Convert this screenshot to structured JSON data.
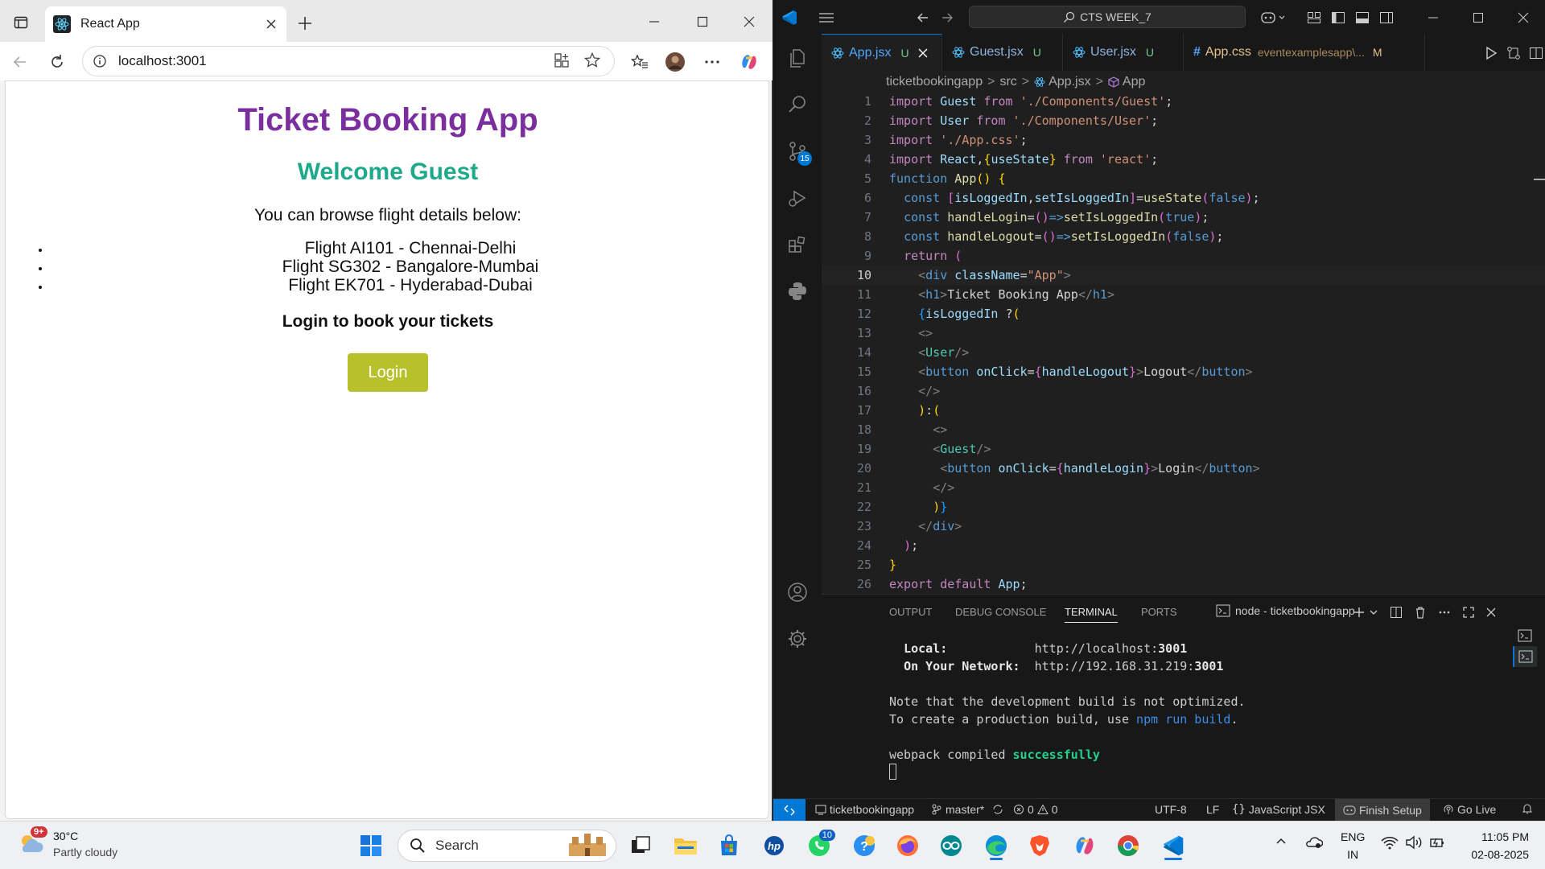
{
  "browser": {
    "tab_title": "React App",
    "url": "localhost:3001"
  },
  "app": {
    "heading": "Ticket Booking App",
    "welcome": "Welcome Guest",
    "intro": "You can browse flight details below:",
    "flights": [
      "Flight AI101 - Chennai-Delhi",
      "Flight SG302 - Bangalore-Mumbai",
      "Flight EK701 - Hyderabad-Dubai"
    ],
    "login_prompt": "Login to book your tickets",
    "login_button": "Login"
  },
  "vscode": {
    "command_center": "CTS WEEK_7",
    "source_control_badge": "15",
    "tabs": [
      {
        "name": "App.jsx",
        "status": "U"
      },
      {
        "name": "Guest.jsx",
        "status": "U"
      },
      {
        "name": "User.jsx",
        "status": "U"
      },
      {
        "name": "App.css",
        "detail": "eventexamplesapp\\...",
        "status": "M"
      }
    ],
    "breadcrumb": [
      "ticketbookingapp",
      "src",
      "App.jsx",
      "App"
    ],
    "line_numbers": [
      "1",
      "2",
      "3",
      "4",
      "5",
      "6",
      "7",
      "8",
      "9",
      "10",
      "11",
      "12",
      "13",
      "14",
      "15",
      "16",
      "17",
      "18",
      "19",
      "20",
      "21",
      "22",
      "23",
      "24",
      "25",
      "26"
    ],
    "panel_tabs": [
      "OUTPUT",
      "DEBUG CONSOLE",
      "TERMINAL",
      "PORTS"
    ],
    "terminal_name": "node - ticketbookingapp",
    "terminal": {
      "local_label": "Local:",
      "local_url": "http://localhost:",
      "local_port": "3001",
      "network_label": "On Your Network:",
      "network_url": "http://192.168.31.219:",
      "network_port": "3001",
      "note1": "Note that the development build is not optimized.",
      "note2_pre": "To create a production build, use ",
      "note2_cmd": "npm run build",
      "note2_post": ".",
      "compiled_pre": "webpack compiled ",
      "compiled_status": "successfully"
    },
    "status": {
      "folder": "ticketbookingapp",
      "branch": "master*",
      "errors": "0",
      "warnings": "0",
      "encoding": "UTF-8",
      "eol": "LF",
      "language": "JavaScript JSX",
      "finish_setup": "Finish Setup",
      "go_live": "Go Live"
    }
  },
  "taskbar": {
    "weather_temp": "30°C",
    "weather_desc": "Partly cloudy",
    "weather_badge": "9+",
    "search": "Search",
    "whatsapp_badge": "10",
    "lang_top": "ENG",
    "lang_bottom": "IN",
    "time": "11:05 PM",
    "date": "02-08-2025"
  },
  "colors": {
    "heading": "#7b2f9e",
    "welcome": "#1fa98b",
    "login_button": "#b8c12c",
    "vscode_accent": "#0078d4"
  }
}
